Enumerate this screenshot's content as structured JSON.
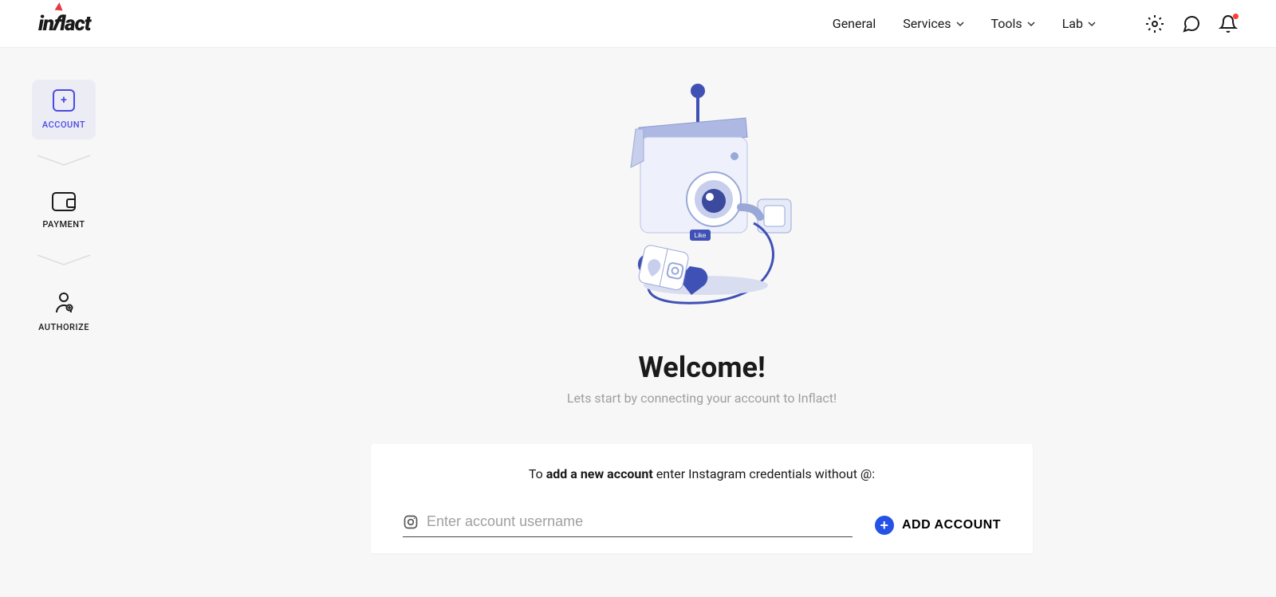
{
  "brand": {
    "name": "inflact"
  },
  "header": {
    "nav": [
      {
        "label": "General",
        "has_dropdown": false
      },
      {
        "label": "Services",
        "has_dropdown": true
      },
      {
        "label": "Tools",
        "has_dropdown": true
      },
      {
        "label": "Lab",
        "has_dropdown": true
      }
    ]
  },
  "sidebar": {
    "items": [
      {
        "label": "ACCOUNT"
      },
      {
        "label": "PAYMENT"
      },
      {
        "label": "AUTHORIZE"
      }
    ]
  },
  "main": {
    "title": "Welcome!",
    "subtitle": "Lets start by connecting your account to Inflact!",
    "card_prefix": "To ",
    "card_bold": "add a new account",
    "card_suffix": " enter Instagram credentials without @:",
    "input_placeholder": "Enter account username",
    "add_button": "ADD ACCOUNT"
  }
}
